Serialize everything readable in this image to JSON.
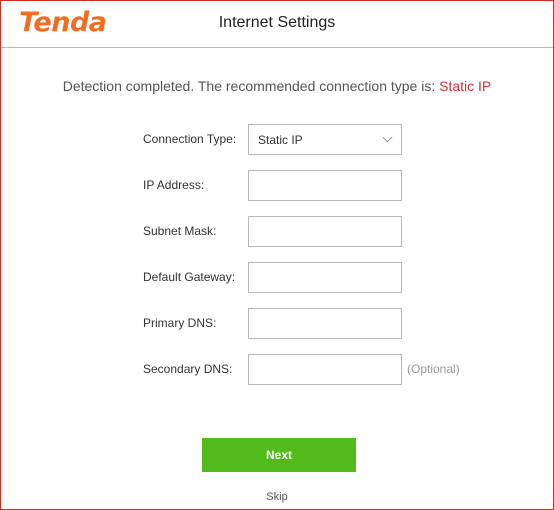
{
  "header": {
    "logo_text": "Tenda",
    "title": "Internet Settings"
  },
  "detection": {
    "message": "Detection completed. The recommended connection type is: ",
    "recommended_type": "Static IP"
  },
  "form": {
    "connection_type": {
      "label": "Connection Type:",
      "selected": "Static IP"
    },
    "ip_address": {
      "label": "IP Address:",
      "value": ""
    },
    "subnet_mask": {
      "label": "Subnet Mask:",
      "value": ""
    },
    "default_gateway": {
      "label": "Default Gateway:",
      "value": ""
    },
    "primary_dns": {
      "label": "Primary DNS:",
      "value": ""
    },
    "secondary_dns": {
      "label": "Secondary DNS:",
      "value": "",
      "hint": "(Optional)"
    }
  },
  "actions": {
    "next_label": "Next",
    "skip_label": "Skip"
  },
  "colors": {
    "brand": "#f26d21",
    "accent": "#e02d3c",
    "primary_button": "#53ba1c",
    "frame_border": "#d9281e"
  }
}
